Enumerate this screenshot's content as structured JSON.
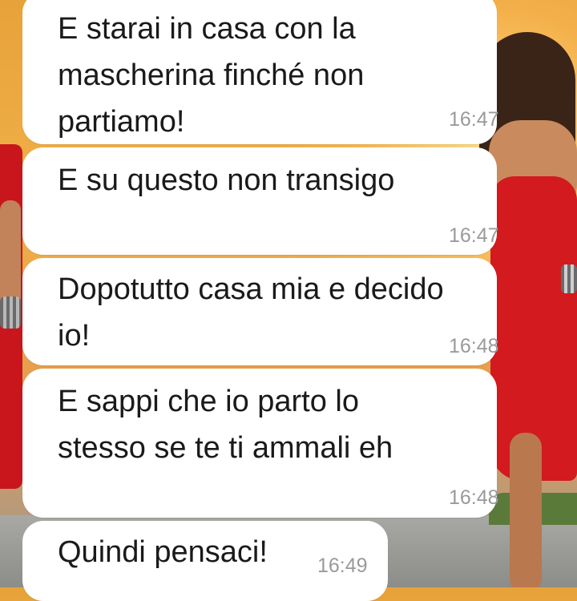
{
  "messages": [
    {
      "text": "E starai in casa con la\nmascherina finché non\npartiamo!",
      "time": "16:47"
    },
    {
      "text": "E su questo non transigo",
      "time": "16:47"
    },
    {
      "text": "Dopotutto casa mia e decido\nio!",
      "time": "16:48"
    },
    {
      "text": "E sappi che io parto lo\nstesso se te ti ammali eh",
      "time": "16:48"
    },
    {
      "text": "Quindi pensaci!",
      "time": "16:49"
    }
  ],
  "colors": {
    "bubble": "#ffffff",
    "text": "#1a1a1a",
    "timestamp": "#9a9a9a",
    "wallpaper_sky": "#f0b04a",
    "wallpaper_dress": "#d21a1f"
  }
}
